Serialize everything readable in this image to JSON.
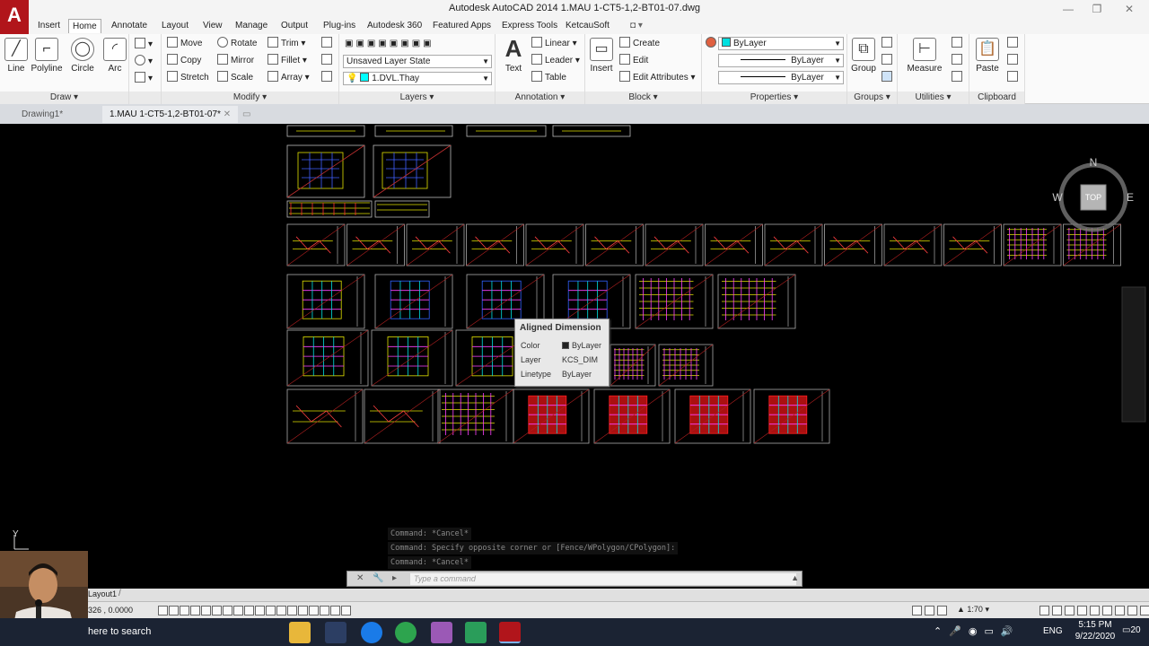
{
  "window": {
    "title": "Autodesk AutoCAD 2014    1.MAU 1-CT5-1,2-BT01-07.dwg",
    "app_logo": "A"
  },
  "menu_tabs": [
    "Insert",
    "Home",
    "Annotate",
    "Layout",
    "View",
    "Manage",
    "Output",
    "Plug-ins",
    "Autodesk 360",
    "Featured Apps",
    "Express Tools",
    "KetcauSoft"
  ],
  "active_tab": "Home",
  "ribbon": {
    "draw": {
      "title": "Draw",
      "line": "Line",
      "polyline": "Polyline",
      "circle": "Circle",
      "arc": "Arc"
    },
    "modify": {
      "title": "Modify",
      "move": "Move",
      "rotate": "Rotate",
      "trim": "Trim",
      "copy": "Copy",
      "mirror": "Mirror",
      "fillet": "Fillet",
      "stretch": "Stretch",
      "scale": "Scale",
      "array": "Array"
    },
    "layers": {
      "title": "Layers",
      "layer_state": "Unsaved Layer State",
      "current_layer": "1.DVL.Thay"
    },
    "annotation": {
      "title": "Annotation",
      "text": "Text",
      "linear": "Linear",
      "leader": "Leader",
      "table": "Table"
    },
    "block": {
      "title": "Block",
      "insert": "Insert",
      "create": "Create",
      "edit": "Edit",
      "edit_attributes": "Edit Attributes"
    },
    "properties": {
      "title": "Properties",
      "color": "ByLayer",
      "lineweight": "ByLayer",
      "linetype": "ByLayer"
    },
    "groups": {
      "title": "Groups",
      "group": "Group"
    },
    "utilities": {
      "title": "Utilities",
      "measure": "Measure"
    },
    "clipboard": {
      "title": "Clipboard",
      "paste": "Paste"
    }
  },
  "doc_tabs": [
    "Drawing1*",
    "1.MAU 1-CT5-1,2-BT01-07*"
  ],
  "viewcube": {
    "n": "N",
    "w": "W",
    "e": "E",
    "top": "TOP"
  },
  "tooltip": {
    "title": "Aligned Dimension",
    "rows": [
      {
        "key": "Color",
        "value": "ByLayer"
      },
      {
        "key": "Layer",
        "value": "KCS_DIM"
      },
      {
        "key": "Linetype",
        "value": "ByLayer"
      }
    ]
  },
  "command_history": [
    "Command: *Cancel*",
    "Command: Specify opposite corner or [Fence/WPolygon/CPolygon]:",
    "Command: *Cancel*"
  ],
  "command_placeholder": "Type a command",
  "layout_tab": "Layout1",
  "coordinates": "326 , 0.0000",
  "annotation_scale": "1:70",
  "taskbar": {
    "search": "here to search",
    "lang": "ENG",
    "time": "5:15 PM",
    "date": "9/22/2020",
    "notifications": "20"
  },
  "ucs": {
    "y": "Y"
  },
  "colors": {
    "accent": "#b1151b",
    "background": "#000000",
    "taskbar": "#1b2333"
  }
}
